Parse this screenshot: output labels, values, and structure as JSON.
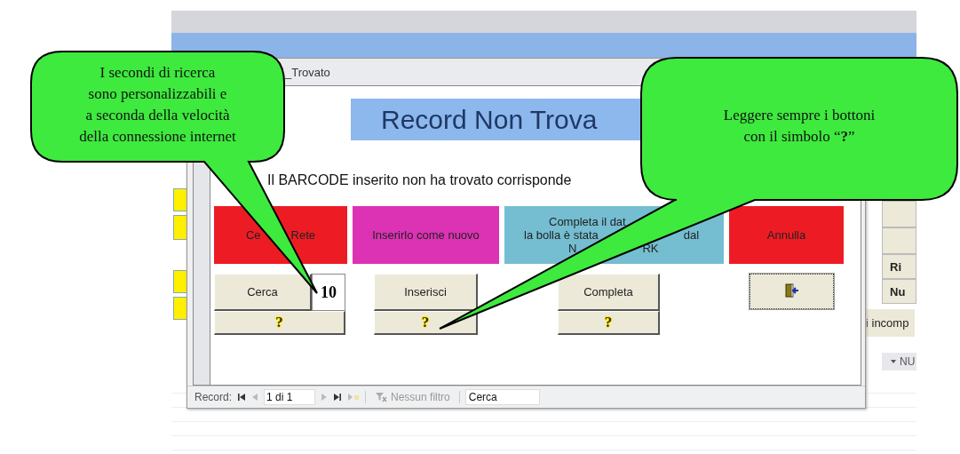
{
  "background": {
    "side_buttons": [
      "Ri",
      "Nu"
    ],
    "side_label": "i incomp",
    "column_header": "NU"
  },
  "dialog": {
    "title": "_Trovato",
    "heading": "Record Non Trova",
    "message": "Il BARCODE inserito non ha trovato corrisponde",
    "actions": [
      {
        "color": "#ed1c24",
        "lines": [
          [
            "Ce",
            "Rete"
          ]
        ]
      },
      {
        "color": "#dc32b4",
        "lines": [
          [
            "Inserirlo come nuovo"
          ]
        ]
      },
      {
        "color": "#75bdd1",
        "lines": [
          [
            "Completa il dat"
          ],
          [
            "la bolla è  stata",
            "dal"
          ],
          [
            "N",
            "RK"
          ]
        ]
      },
      {
        "color": "#ed1c24",
        "lines": [
          [
            "Annulla"
          ]
        ]
      }
    ],
    "buttons": [
      {
        "kind": "search",
        "label": "Cerca",
        "seconds": "10",
        "help": "?"
      },
      {
        "kind": "plain",
        "label": "Inserisci",
        "help": "?"
      },
      {
        "kind": "plain",
        "label": "Completa",
        "help": "?"
      },
      {
        "kind": "exit"
      }
    ],
    "nav": {
      "label": "Record:",
      "position": "1 di 1",
      "filter": "Nessun filtro",
      "search": "Cerca"
    }
  },
  "callouts": [
    {
      "lines": [
        "I secondi di ricerca",
        "sono personalizzabili e",
        "a seconda della velocità",
        "della connessione internet"
      ]
    },
    {
      "lines": [
        "Leggere sempre i bottoni",
        "con il simbolo  “**?**”"
      ]
    }
  ]
}
